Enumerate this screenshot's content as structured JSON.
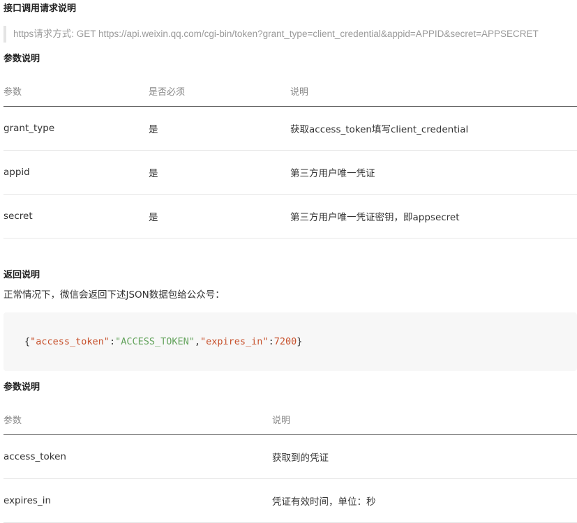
{
  "headings": {
    "request": "接口调用请求说明",
    "params": "参数说明",
    "response": "返回说明",
    "response_params": "参数说明"
  },
  "request_line": "https请求方式: GET https://api.weixin.qq.com/cgi-bin/token?grant_type=client_credential&appid=APPID&secret=APPSECRET",
  "request_params_table": {
    "headers": [
      "参数",
      "是否必须",
      "说明"
    ],
    "rows": [
      [
        "grant_type",
        "是",
        "获取access_token填写client_credential"
      ],
      [
        "appid",
        "是",
        "第三方用户唯一凭证"
      ],
      [
        "secret",
        "是",
        "第三方用户唯一凭证密钥，即appsecret"
      ]
    ]
  },
  "response_intro": "正常情况下，微信会返回下述JSON数据包给公众号：",
  "code": {
    "open_brace": "{",
    "key1": "\"access_token\"",
    "colon": ":",
    "value1": "\"ACCESS_TOKEN\"",
    "comma": ",",
    "key2": "\"expires_in\"",
    "value2": "7200",
    "close_brace": "}"
  },
  "response_params_table": {
    "headers": [
      "参数",
      "说明"
    ],
    "rows": [
      [
        "access_token",
        "获取到的凭证"
      ],
      [
        "expires_in",
        "凭证有效时间，单位：秒"
      ]
    ]
  }
}
